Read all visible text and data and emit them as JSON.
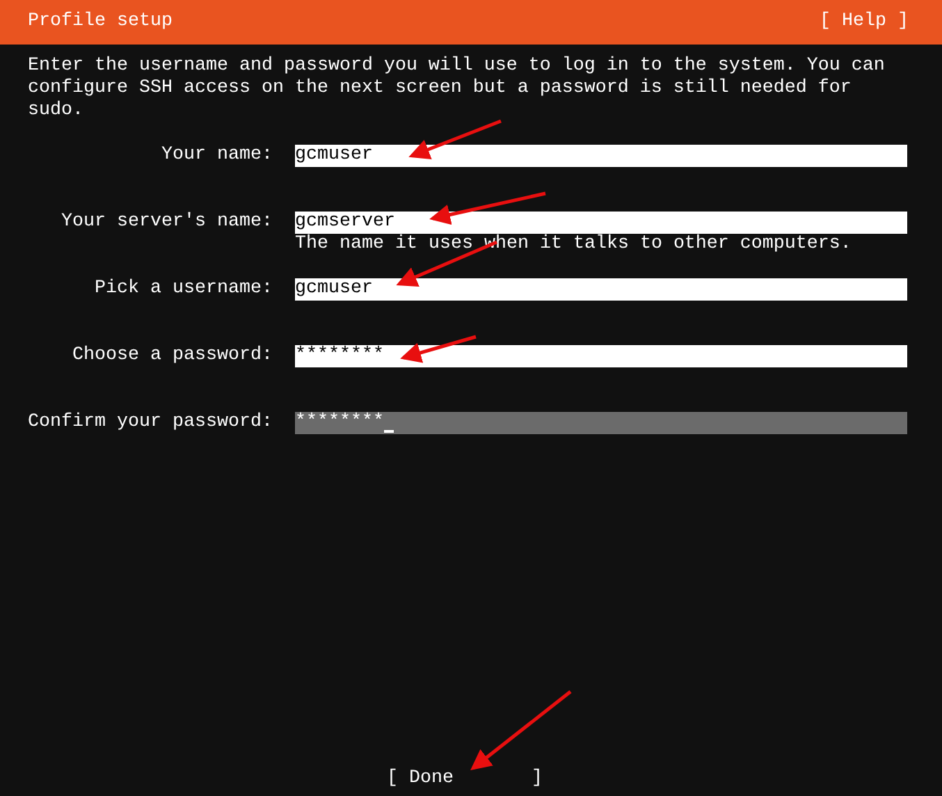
{
  "header": {
    "title": "Profile setup",
    "help_button": "[ Help ]"
  },
  "intro": "Enter the username and password you will use to log in to the system. You can configure SSH access on the next screen but a password is still needed for sudo.",
  "fields": [
    {
      "label": "Your name:",
      "value": "gcmuser",
      "focused": false
    },
    {
      "label": "Your server's name:",
      "value": "gcmserver",
      "hint": "The name it uses when it talks to other computers.",
      "focused": false
    },
    {
      "label": "Pick a username:",
      "value": "gcmuser",
      "focused": false
    },
    {
      "label": "Choose a password:",
      "value": "********",
      "focused": false
    },
    {
      "label": "Confirm your password:",
      "value": "********",
      "focused": true
    }
  ],
  "done_button": "[ Done       ]"
}
